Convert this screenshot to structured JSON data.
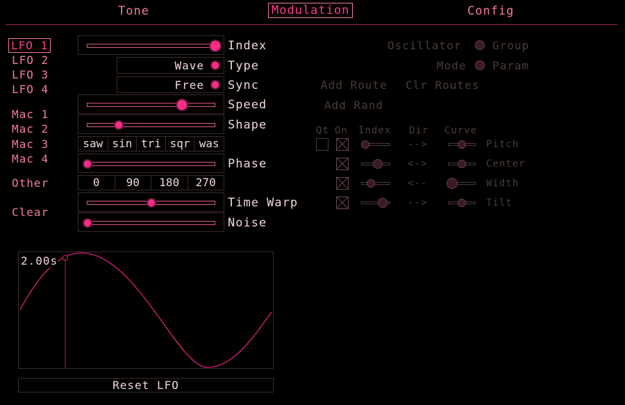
{
  "tabs": [
    "Tone",
    "Modulation",
    "Config"
  ],
  "lfo_nav": [
    "LFO 1",
    "LFO 2",
    "LFO 3",
    "LFO 4"
  ],
  "mac_nav": [
    "Mac 1",
    "Mac 2",
    "Mac 3",
    "Mac 4"
  ],
  "other_label": "Other",
  "clear_label": "Clear",
  "params": {
    "index": "Index",
    "type": "Type",
    "type_value": "Wave",
    "sync": "Sync",
    "sync_value": "Free",
    "speed": "Speed",
    "shape": "Shape",
    "phase": "Phase",
    "time_warp": "Time Warp",
    "noise": "Noise"
  },
  "levels": {
    "index": 1.0,
    "speed": 0.74,
    "shape": 0.25,
    "phase": 0.0,
    "time_warp": 0.5,
    "noise": 0.0
  },
  "wave_buttons": [
    "saw",
    "sin",
    "tri",
    "sqr",
    "was"
  ],
  "phase_buttons": [
    "0",
    "90",
    "180",
    "270"
  ],
  "routing": {
    "oscillator": "Oscillator",
    "group": "Group",
    "mode": "Mode",
    "param": "Param",
    "add_route": "Add Route",
    "clr_routes": "Clr Routes",
    "add_rand": "Add Rand",
    "headers": [
      "Qt",
      "On",
      "Index",
      "Dir",
      "Curve"
    ],
    "rows": [
      {
        "dir": "-->",
        "target": "Pitch"
      },
      {
        "dir": "<->",
        "target": "Center"
      },
      {
        "dir": "<--",
        "target": "Width"
      },
      {
        "dir": "-->",
        "target": "Tilt"
      }
    ]
  },
  "preview": {
    "time_label": "2.00s",
    "reset_label": "Reset LFO"
  },
  "colors": {
    "accent": "#ff2c8a",
    "text": "#f27ca0",
    "wave": "#e0207a",
    "dim": "#4a3a40"
  }
}
